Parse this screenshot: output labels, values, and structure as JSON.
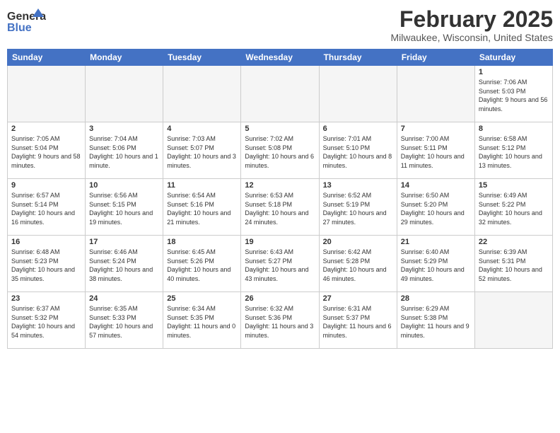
{
  "header": {
    "logo_line1": "General",
    "logo_line2": "Blue",
    "month_title": "February 2025",
    "location": "Milwaukee, Wisconsin, United States"
  },
  "weekdays": [
    "Sunday",
    "Monday",
    "Tuesday",
    "Wednesday",
    "Thursday",
    "Friday",
    "Saturday"
  ],
  "weeks": [
    [
      {
        "day": "",
        "info": ""
      },
      {
        "day": "",
        "info": ""
      },
      {
        "day": "",
        "info": ""
      },
      {
        "day": "",
        "info": ""
      },
      {
        "day": "",
        "info": ""
      },
      {
        "day": "",
        "info": ""
      },
      {
        "day": "1",
        "info": "Sunrise: 7:06 AM\nSunset: 5:03 PM\nDaylight: 9 hours and 56 minutes."
      }
    ],
    [
      {
        "day": "2",
        "info": "Sunrise: 7:05 AM\nSunset: 5:04 PM\nDaylight: 9 hours and 58 minutes."
      },
      {
        "day": "3",
        "info": "Sunrise: 7:04 AM\nSunset: 5:06 PM\nDaylight: 10 hours and 1 minute."
      },
      {
        "day": "4",
        "info": "Sunrise: 7:03 AM\nSunset: 5:07 PM\nDaylight: 10 hours and 3 minutes."
      },
      {
        "day": "5",
        "info": "Sunrise: 7:02 AM\nSunset: 5:08 PM\nDaylight: 10 hours and 6 minutes."
      },
      {
        "day": "6",
        "info": "Sunrise: 7:01 AM\nSunset: 5:10 PM\nDaylight: 10 hours and 8 minutes."
      },
      {
        "day": "7",
        "info": "Sunrise: 7:00 AM\nSunset: 5:11 PM\nDaylight: 10 hours and 11 minutes."
      },
      {
        "day": "8",
        "info": "Sunrise: 6:58 AM\nSunset: 5:12 PM\nDaylight: 10 hours and 13 minutes."
      }
    ],
    [
      {
        "day": "9",
        "info": "Sunrise: 6:57 AM\nSunset: 5:14 PM\nDaylight: 10 hours and 16 minutes."
      },
      {
        "day": "10",
        "info": "Sunrise: 6:56 AM\nSunset: 5:15 PM\nDaylight: 10 hours and 19 minutes."
      },
      {
        "day": "11",
        "info": "Sunrise: 6:54 AM\nSunset: 5:16 PM\nDaylight: 10 hours and 21 minutes."
      },
      {
        "day": "12",
        "info": "Sunrise: 6:53 AM\nSunset: 5:18 PM\nDaylight: 10 hours and 24 minutes."
      },
      {
        "day": "13",
        "info": "Sunrise: 6:52 AM\nSunset: 5:19 PM\nDaylight: 10 hours and 27 minutes."
      },
      {
        "day": "14",
        "info": "Sunrise: 6:50 AM\nSunset: 5:20 PM\nDaylight: 10 hours and 29 minutes."
      },
      {
        "day": "15",
        "info": "Sunrise: 6:49 AM\nSunset: 5:22 PM\nDaylight: 10 hours and 32 minutes."
      }
    ],
    [
      {
        "day": "16",
        "info": "Sunrise: 6:48 AM\nSunset: 5:23 PM\nDaylight: 10 hours and 35 minutes."
      },
      {
        "day": "17",
        "info": "Sunrise: 6:46 AM\nSunset: 5:24 PM\nDaylight: 10 hours and 38 minutes."
      },
      {
        "day": "18",
        "info": "Sunrise: 6:45 AM\nSunset: 5:26 PM\nDaylight: 10 hours and 40 minutes."
      },
      {
        "day": "19",
        "info": "Sunrise: 6:43 AM\nSunset: 5:27 PM\nDaylight: 10 hours and 43 minutes."
      },
      {
        "day": "20",
        "info": "Sunrise: 6:42 AM\nSunset: 5:28 PM\nDaylight: 10 hours and 46 minutes."
      },
      {
        "day": "21",
        "info": "Sunrise: 6:40 AM\nSunset: 5:29 PM\nDaylight: 10 hours and 49 minutes."
      },
      {
        "day": "22",
        "info": "Sunrise: 6:39 AM\nSunset: 5:31 PM\nDaylight: 10 hours and 52 minutes."
      }
    ],
    [
      {
        "day": "23",
        "info": "Sunrise: 6:37 AM\nSunset: 5:32 PM\nDaylight: 10 hours and 54 minutes."
      },
      {
        "day": "24",
        "info": "Sunrise: 6:35 AM\nSunset: 5:33 PM\nDaylight: 10 hours and 57 minutes."
      },
      {
        "day": "25",
        "info": "Sunrise: 6:34 AM\nSunset: 5:35 PM\nDaylight: 11 hours and 0 minutes."
      },
      {
        "day": "26",
        "info": "Sunrise: 6:32 AM\nSunset: 5:36 PM\nDaylight: 11 hours and 3 minutes."
      },
      {
        "day": "27",
        "info": "Sunrise: 6:31 AM\nSunset: 5:37 PM\nDaylight: 11 hours and 6 minutes."
      },
      {
        "day": "28",
        "info": "Sunrise: 6:29 AM\nSunset: 5:38 PM\nDaylight: 11 hours and 9 minutes."
      },
      {
        "day": "",
        "info": ""
      }
    ]
  ]
}
